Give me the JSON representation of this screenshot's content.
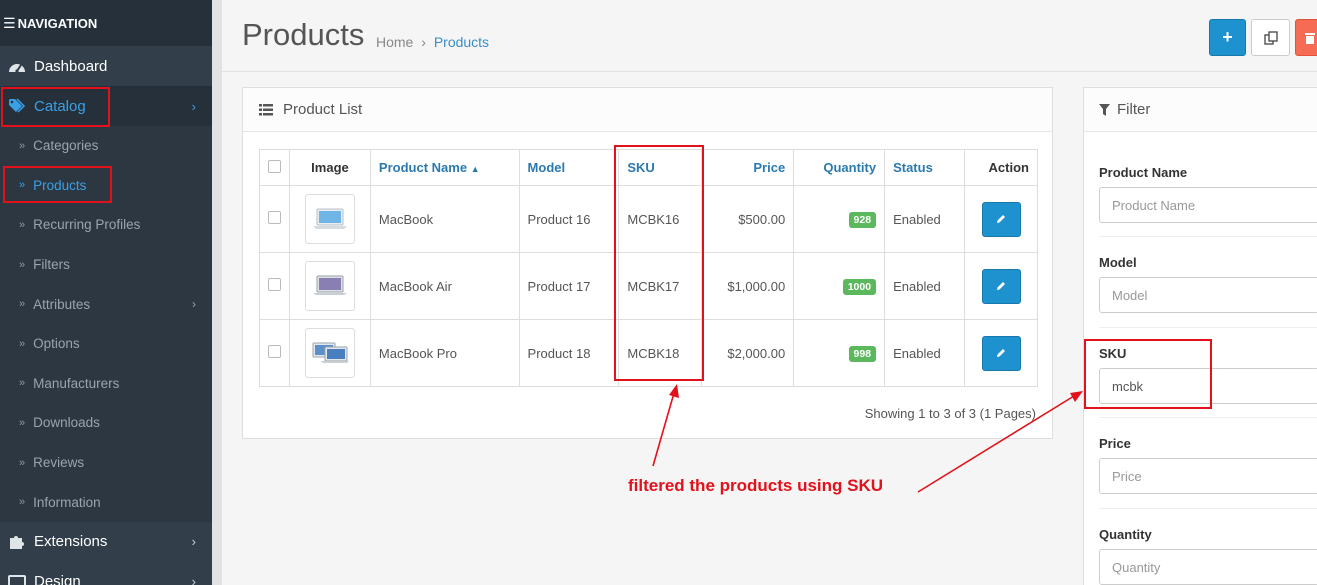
{
  "sidebar": {
    "nav_title": "NAVIGATION",
    "dashboard": "Dashboard",
    "catalog": "Catalog",
    "catalog_items": [
      {
        "label": "Categories"
      },
      {
        "label": "Products"
      },
      {
        "label": "Recurring Profiles"
      },
      {
        "label": "Filters"
      },
      {
        "label": "Attributes"
      },
      {
        "label": "Options"
      },
      {
        "label": "Manufacturers"
      },
      {
        "label": "Downloads"
      },
      {
        "label": "Reviews"
      },
      {
        "label": "Information"
      }
    ],
    "extensions": "Extensions",
    "design": "Design"
  },
  "header": {
    "title": "Products",
    "breadcrumb_home": "Home",
    "breadcrumb_sep": "›",
    "breadcrumb_current": "Products"
  },
  "product_list": {
    "title": "Product List",
    "columns": {
      "image": "Image",
      "name": "Product Name",
      "model": "Model",
      "sku": "SKU",
      "price": "Price",
      "quantity": "Quantity",
      "status": "Status",
      "action": "Action"
    },
    "rows": [
      {
        "name": "MacBook",
        "model": "Product 16",
        "sku": "MCBK16",
        "price": "$500.00",
        "quantity": "928",
        "status": "Enabled"
      },
      {
        "name": "MacBook Air",
        "model": "Product 17",
        "sku": "MCBK17",
        "price": "$1,000.00",
        "quantity": "1000",
        "status": "Enabled"
      },
      {
        "name": "MacBook Pro",
        "model": "Product 18",
        "sku": "MCBK18",
        "price": "$2,000.00",
        "quantity": "998",
        "status": "Enabled"
      }
    ],
    "showing": "Showing 1 to 3 of 3 (1 Pages)"
  },
  "filter": {
    "title": "Filter",
    "product_name_label": "Product Name",
    "product_name_placeholder": "Product Name",
    "model_label": "Model",
    "model_placeholder": "Model",
    "sku_label": "SKU",
    "sku_value": "mcbk",
    "price_label": "Price",
    "price_placeholder": "Price",
    "quantity_label": "Quantity",
    "quantity_placeholder": "Quantity"
  },
  "annotation": {
    "text": "filtered the products using SKU",
    "color": "#e3111b"
  },
  "colors": {
    "sidebar_bg": "#323e4a",
    "accent": "#1e91cf",
    "quantity_badge": "#5cb85c",
    "delete": "#f56b53"
  }
}
